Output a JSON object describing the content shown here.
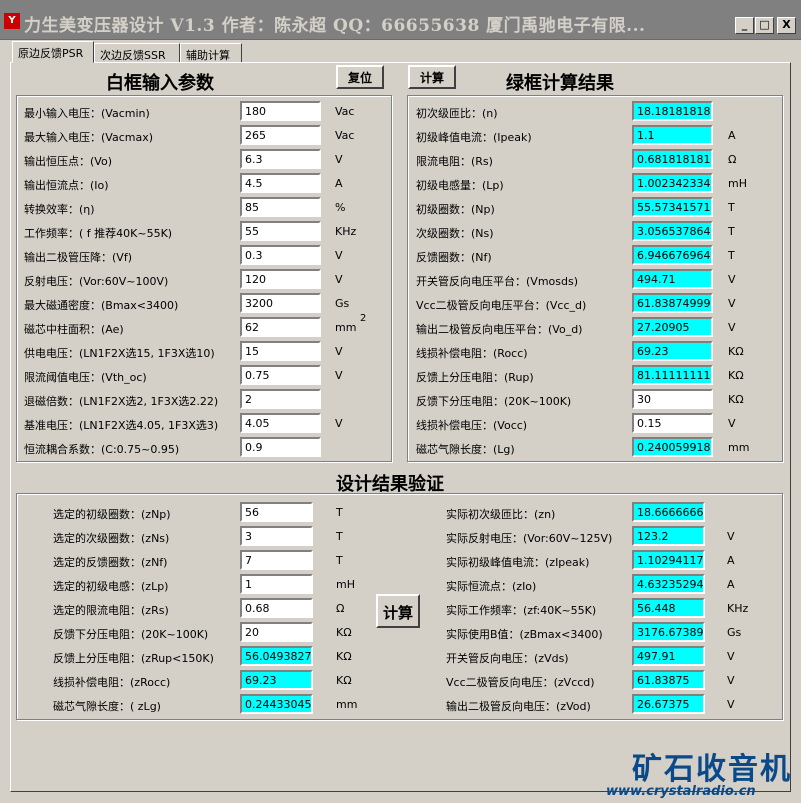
{
  "window": {
    "title": "力生美变压器设计 V1.3 作者：陈永超 QQ：66655638 厦门禹驰电子有限...",
    "logo": "Y"
  },
  "tabs": [
    "原边反馈PSR",
    "次边反馈SSR",
    "辅助计算"
  ],
  "left": {
    "title": "白框输入参数",
    "reset_button": "复位",
    "rows": [
      {
        "label": "最小输入电压：(Vacmin)",
        "value": "180",
        "unit": "Vac"
      },
      {
        "label": "最大输入电压：(Vacmax)",
        "value": "265",
        "unit": "Vac"
      },
      {
        "label": "输出恒压点：(Vo)",
        "value": "6.3",
        "unit": "V"
      },
      {
        "label": "输出恒流点：(Io)",
        "value": "4.5",
        "unit": "A"
      },
      {
        "label": "转换效率：(η)",
        "value": "85",
        "unit": "%"
      },
      {
        "label": "工作频率：( f 推荐40K~55K)",
        "value": "55",
        "unit": "KHz"
      },
      {
        "label": "输出二极管压降：(Vf)",
        "value": "0.3",
        "unit": "V"
      },
      {
        "label": "反射电压：(Vor:60V~100V)",
        "value": "120",
        "unit": "V"
      },
      {
        "label": "最大磁通密度：(Bmax<3400)",
        "value": "3200",
        "unit": "Gs"
      },
      {
        "label": "磁芯中柱面积：(Ae)",
        "value": "62",
        "unit": "mm"
      },
      {
        "label": "供电电压：(LN1F2X选15, 1F3X选10)",
        "value": "15",
        "unit": "V"
      },
      {
        "label": "限流阈值电压：(Vth_oc)",
        "value": "0.75",
        "unit": "V"
      },
      {
        "label": "退磁倍数：(LN1F2X选2, 1F3X选2.22)",
        "value": "2",
        "unit": ""
      },
      {
        "label": "基准电压：(LN1F2X选4.05, 1F3X选3)",
        "value": "4.05",
        "unit": "V"
      },
      {
        "label": "恒流耦合系数：(C:0.75~0.95)",
        "value": "0.9",
        "unit": ""
      }
    ],
    "ae_superscript": "2"
  },
  "right": {
    "title": "绿框计算结果",
    "calc_button": "计算",
    "rows": [
      {
        "label": "初次级匝比：(n)",
        "value": "18.1818181818",
        "unit": "",
        "cyan": true
      },
      {
        "label": "初级峰值电流：(Ipeak)",
        "value": "1.1",
        "unit": "A",
        "cyan": true
      },
      {
        "label": "限流电阻：(Rs)",
        "value": "0.68181818181",
        "unit": "Ω",
        "cyan": true
      },
      {
        "label": "初级电感量：(Lp)",
        "value": "1.00234233437",
        "unit": "mH",
        "cyan": true
      },
      {
        "label": "初级圈数：(Np)",
        "value": "55.5734157165",
        "unit": "T",
        "cyan": true
      },
      {
        "label": "次级圈数：(Ns)",
        "value": "3.05653786441",
        "unit": "T",
        "cyan": true
      },
      {
        "label": "反馈圈数：(Nf)",
        "value": "6.94667696457",
        "unit": "T",
        "cyan": true
      },
      {
        "label": "开关管反向电压平台：(Vmosds)",
        "value": "494.71",
        "unit": "V",
        "cyan": true
      },
      {
        "label": "Vcc二极管反向电压平台：(Vcc_d)",
        "value": "61.8387499999",
        "unit": "V",
        "cyan": true
      },
      {
        "label": "输出二极管反向电压平台：(Vo_d)",
        "value": "27.20905",
        "unit": "V",
        "cyan": true
      },
      {
        "label": "线损补偿电阻：(Rocc)",
        "value": "69.23",
        "unit": "KΩ",
        "cyan": true
      },
      {
        "label": "反馈上分压电阻：(Rup)",
        "value": "81.1111111111",
        "unit": "KΩ",
        "cyan": true
      },
      {
        "label": "反馈下分压电阻：(20K~100K)",
        "value": "30",
        "unit": "KΩ",
        "cyan": false
      },
      {
        "label": "线损补偿电压：(Vocc)",
        "value": "0.15",
        "unit": "V",
        "cyan": false
      },
      {
        "label": "磁芯气隙长度：(Lg)",
        "value": "0.24005991841",
        "unit": "mm",
        "cyan": true
      }
    ]
  },
  "verify": {
    "title": "设计结果验证",
    "calc_button": "计算",
    "left_rows": [
      {
        "label": "选定的初级圈数：(zNp)",
        "value": "56",
        "unit": "T",
        "cyan": false
      },
      {
        "label": "选定的次级圈数：(zNs)",
        "value": "3",
        "unit": "T",
        "cyan": false
      },
      {
        "label": "选定的反馈圈数：(zNf)",
        "value": "7",
        "unit": "T",
        "cyan": false
      },
      {
        "label": "选定的初级电感：(zLp)",
        "value": "1",
        "unit": "mH",
        "cyan": false
      },
      {
        "label": "选定的限流电阻：(zRs)",
        "value": "0.68",
        "unit": "Ω",
        "cyan": false
      },
      {
        "label": "反馈下分压电阻：(20K~100K)",
        "value": "20",
        "unit": "KΩ",
        "cyan": false
      },
      {
        "label": "反馈上分压电阻：(zRup<150K)",
        "value": "56.0493827160",
        "unit": "KΩ",
        "cyan": true
      },
      {
        "label": "线损补偿电阻：(zRocc)",
        "value": "69.23",
        "unit": "KΩ",
        "cyan": true
      },
      {
        "label": "磁芯气隙长度：( zLg)",
        "value": "0.24433045294",
        "unit": "mm",
        "cyan": true
      }
    ],
    "right_rows": [
      {
        "label": "实际初次级匝比：(zn)",
        "value": "18.6666666666",
        "unit": "",
        "cyan": true
      },
      {
        "label": "实际反射电压：(Vor:60V~125V)",
        "value": "123.2",
        "unit": "V",
        "cyan": true
      },
      {
        "label": "实际初级峰值电流：(zIpeak)",
        "value": "1.10294117647",
        "unit": "A",
        "cyan": true
      },
      {
        "label": "实际恒流点：(zIo)",
        "value": "4.63235294117",
        "unit": "A",
        "cyan": true
      },
      {
        "label": "实际工作频率：(zf:40K~55K)",
        "value": "56.448",
        "unit": "KHz",
        "cyan": true
      },
      {
        "label": "实际使用B值：(zBmax<3400)",
        "value": "3176.67389538",
        "unit": "Gs",
        "cyan": true
      },
      {
        "label": "开关管反向电压：(zVds)",
        "value": "497.91",
        "unit": "V",
        "cyan": true
      },
      {
        "label": "Vcc二极管反向电压：(zVccd)",
        "value": "61.83875",
        "unit": "V",
        "cyan": true
      },
      {
        "label": "输出二极管反向电压：(zVod)",
        "value": "26.67375",
        "unit": "V",
        "cyan": true
      }
    ]
  },
  "watermark": {
    "text1": "矿石收音机",
    "text2": "www.crystalradio.cn"
  },
  "controls": {
    "minimize": "_",
    "maximize": "□",
    "close": "X"
  },
  "colors": {
    "result_field": "#00ffff",
    "watermark": "#0a4a8a"
  }
}
